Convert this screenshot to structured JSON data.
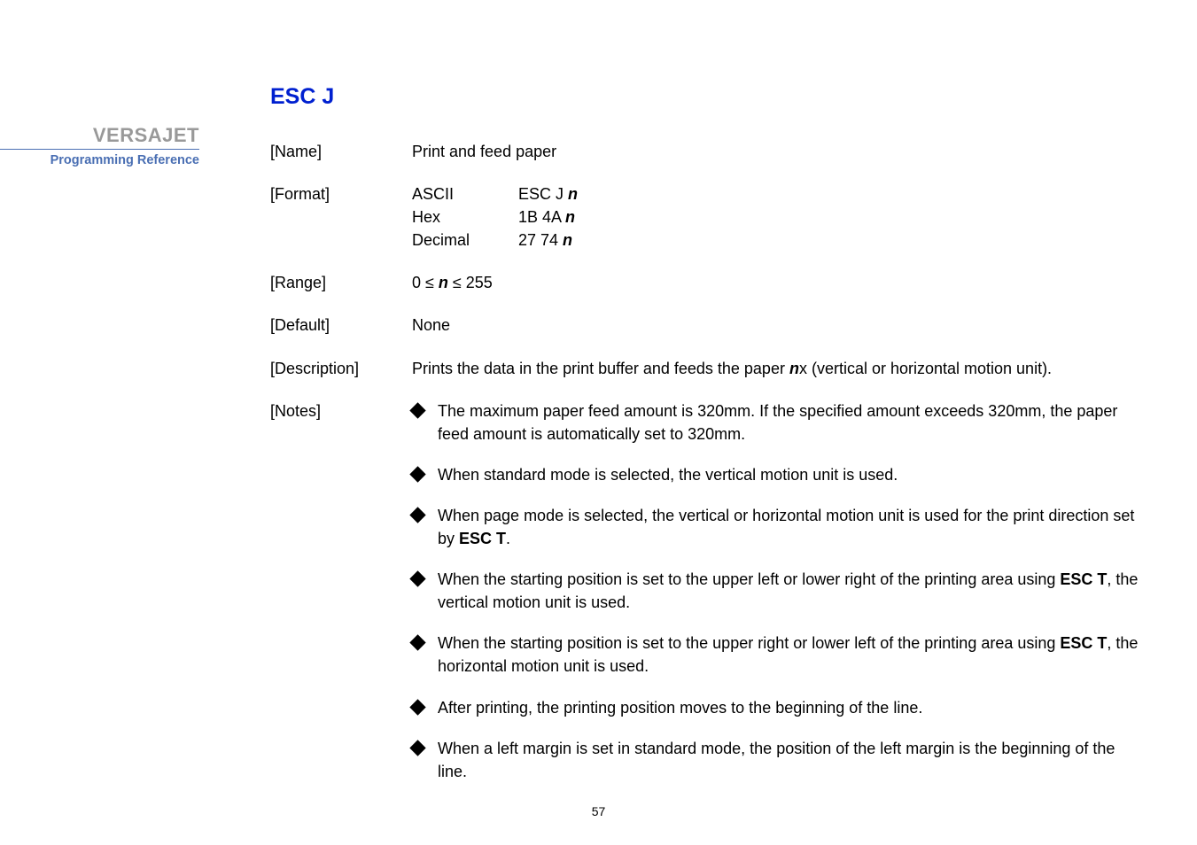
{
  "sidebar": {
    "title": "VERSAJET",
    "subtitle": "Programming Reference"
  },
  "command": {
    "title": "ESC J",
    "name_label": "[Name]",
    "name_value": "Print and feed paper",
    "format_label": "[Format]",
    "format": {
      "ascii_label": "ASCII",
      "ascii_value_pre": "ESC J ",
      "ascii_n": "n",
      "hex_label": "Hex",
      "hex_value_pre": "1B 4A ",
      "hex_n": "n",
      "dec_label": "Decimal",
      "dec_value_pre": "27 74 ",
      "dec_n": "n"
    },
    "range_label": "[Range]",
    "range_pre": "0 ≤ ",
    "range_n": "n",
    "range_post": " ≤ 255",
    "default_label": "[Default]",
    "default_value": "None",
    "desc_label": "[Description]",
    "desc_pre": "Prints the data in the print buffer and feeds the paper ",
    "desc_n": "n",
    "desc_post": "x (vertical or horizontal motion unit).",
    "notes_label": "[Notes]",
    "notes": {
      "n1": "The maximum paper feed amount is 320mm. If the specified amount exceeds 320mm, the paper feed amount is automatically set to 320mm.",
      "n2": "When standard mode is selected, the vertical motion unit is used.",
      "n3_pre": "When page mode is selected, the vertical or horizontal motion unit is used for the print direction set by ",
      "n3_bold": "ESC T",
      "n3_post": ".",
      "n4_pre": "When the starting position is set to the upper left or lower right of the printing area using ",
      "n4_bold": "ESC T",
      "n4_post": ", the vertical motion unit is used.",
      "n5_pre": "When the starting position is set to the upper right or lower left of the printing area using ",
      "n5_bold": "ESC T",
      "n5_post": ", the horizontal motion unit is used.",
      "n6": "After printing, the printing position moves to the beginning of the line.",
      "n7": "When a left margin is set in standard mode, the position of the left margin is the beginning of the line."
    }
  },
  "page_number": "57"
}
